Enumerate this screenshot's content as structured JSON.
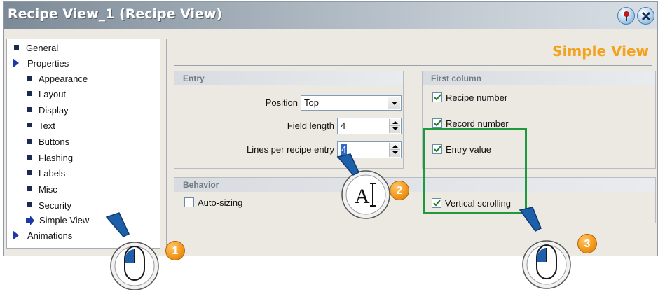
{
  "window": {
    "title": "Recipe View_1 (Recipe View)",
    "help_icon": "pin-help-icon",
    "close_icon": "close-icon"
  },
  "tree": {
    "items": [
      {
        "label": "General",
        "marker": "bullet"
      },
      {
        "label": "Properties",
        "marker": "triangle"
      },
      {
        "label": "Appearance",
        "marker": "bullet"
      },
      {
        "label": "Layout",
        "marker": "bullet"
      },
      {
        "label": "Display",
        "marker": "bullet"
      },
      {
        "label": "Text",
        "marker": "bullet"
      },
      {
        "label": "Buttons",
        "marker": "bullet"
      },
      {
        "label": "Flashing",
        "marker": "bullet"
      },
      {
        "label": "Labels",
        "marker": "bullet"
      },
      {
        "label": "Misc",
        "marker": "bullet"
      },
      {
        "label": "Security",
        "marker": "bullet"
      },
      {
        "label": "Simple View",
        "marker": "arrow",
        "selected": true
      },
      {
        "label": "Animations",
        "marker": "triangle"
      }
    ]
  },
  "main": {
    "section_title": "Simple View",
    "entry": {
      "header": "Entry",
      "position_label": "Position",
      "position_value": "Top",
      "field_length_label": "Field length",
      "field_length_value": "4",
      "lines_label": "Lines per recipe entry",
      "lines_value": "4"
    },
    "behavior": {
      "header": "Behavior",
      "auto_sizing_label": "Auto-sizing",
      "auto_sizing_checked": false
    },
    "first_column": {
      "header": "First column",
      "recipe_number_label": "Recipe number",
      "record_number_label": "Record number",
      "entry_value_label": "Entry value",
      "vertical_scrolling_label": "Vertical scrolling",
      "checked": true
    }
  },
  "callouts": {
    "step1": "1",
    "step2": "2",
    "step3": "3"
  },
  "colors": {
    "accent_title": "#f2a21d",
    "highlight_box": "#1e9a3d",
    "badge": "#f39a1c",
    "cursor_blue": "#1d5fa8"
  }
}
